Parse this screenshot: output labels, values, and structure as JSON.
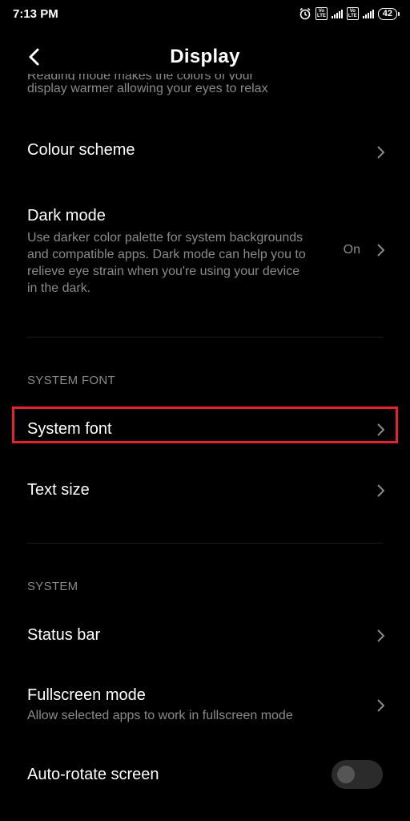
{
  "status_bar": {
    "time": "7:13 PM",
    "battery": "42",
    "volte_1": "Vo LTE",
    "volte_2": "Vo LTE"
  },
  "header": {
    "title": "Display",
    "back_icon": "back-arrow-icon"
  },
  "reading_mode": {
    "desc_partial": "Reading mode makes the colors of your",
    "desc_line2": "display warmer allowing your eyes to relax"
  },
  "colour_scheme": {
    "title": "Colour scheme"
  },
  "dark_mode": {
    "title": "Dark mode",
    "desc": "Use darker color palette for system backgrounds and compatible apps. Dark mode can help you to relieve eye strain when you're using your device in the dark.",
    "value": "On"
  },
  "sections": {
    "system_font": "SYSTEM FONT",
    "system": "SYSTEM"
  },
  "system_font": {
    "title": "System font",
    "highlight_color": "#e3212f"
  },
  "text_size": {
    "title": "Text size"
  },
  "status_bar_item": {
    "title": "Status bar"
  },
  "fullscreen_mode": {
    "title": "Fullscreen mode",
    "desc": "Allow selected apps to work in fullscreen mode"
  },
  "auto_rotate": {
    "title": "Auto-rotate screen",
    "enabled": false
  },
  "colors": {
    "background": "#000000",
    "text": "#ffffff",
    "secondary": "#8a8a8a"
  }
}
